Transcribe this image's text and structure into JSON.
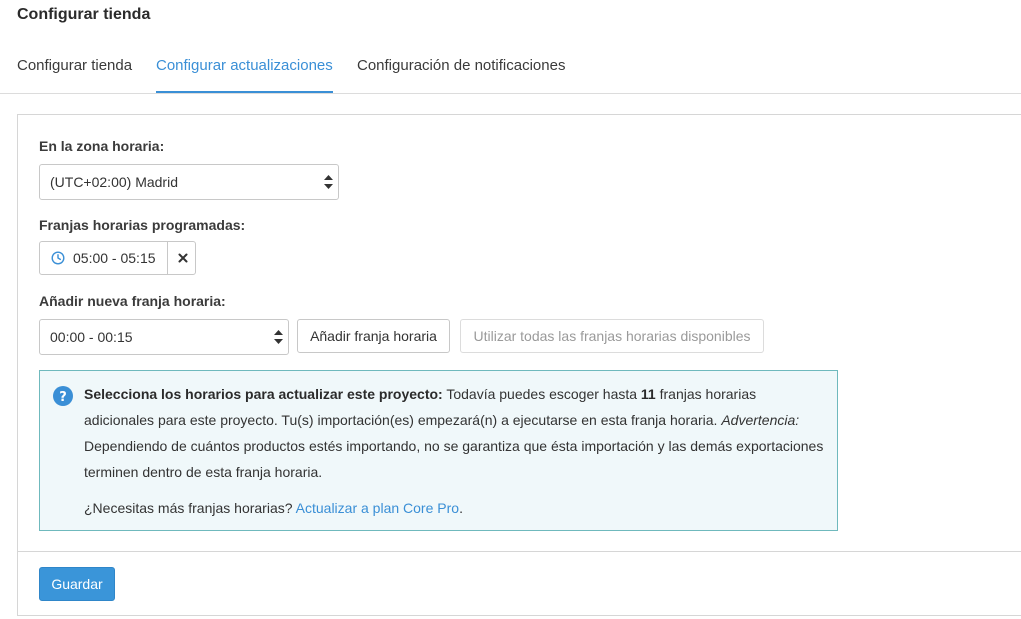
{
  "page": {
    "title": "Configurar tienda"
  },
  "tabs": [
    {
      "label": "Configurar tienda",
      "active": false
    },
    {
      "label": "Configurar actualizaciones",
      "active": true
    },
    {
      "label": "Configuración de notificaciones",
      "active": false
    }
  ],
  "timezone": {
    "label": "En la zona horaria:",
    "value": "(UTC+02:00) Madrid"
  },
  "scheduled": {
    "label": "Franjas horarias programadas:",
    "slots": [
      {
        "time": "05:00 - 05:15",
        "remove_icon": "close-icon"
      }
    ]
  },
  "add_slot": {
    "label": "Añadir nueva franja horaria:",
    "value": "00:00 - 00:15",
    "add_button": "Añadir franja horaria",
    "use_all_button": "Utilizar todas las franjas horarias disponibles"
  },
  "info": {
    "icon": "question-circle-icon",
    "heading": "Selecciona los horarios para actualizar este proyecto:",
    "text1": " Todavía puedes escoger hasta ",
    "count": "11",
    "text2": " franjas horarias adicionales para este proyecto. Tu(s) importación(es) empezará(n) a ejecutarse en esta franja horaria. ",
    "warning_label": "Advertencia:",
    "warning_text": " Dependiendo de cuántos productos estés importando, no se garantiza que ésta importación y las demás exportaciones terminen dentro de esta franja horaria.",
    "more_prefix": "¿Necesitas más franjas horarias? ",
    "upgrade_link": "Actualizar a plan Core Pro",
    "more_suffix": "."
  },
  "footer": {
    "save_label": "Guardar"
  },
  "colors": {
    "accent": "#3a8fd6",
    "primary_button": "#3a95d9",
    "info_bg": "#f0f8fa",
    "info_border": "#6fb9bd"
  }
}
